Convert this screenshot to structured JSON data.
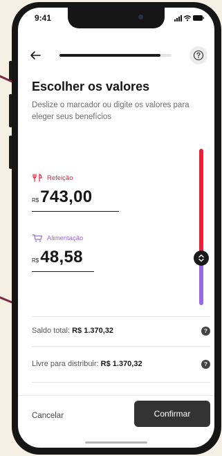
{
  "status_bar": {
    "time": "9:41"
  },
  "header": {
    "progress": 0.9,
    "back_icon": "arrow-left-icon",
    "help_icon": "question-circle-icon"
  },
  "page": {
    "title": "Escolher os valores",
    "subtitle": "Deslize o marcador ou digite os valores para eleger seus benefícios"
  },
  "categories": [
    {
      "label": "Refeição",
      "currency": "R$",
      "amount": "743,00",
      "color": "#e5213b",
      "icon": "fork-knife-icon"
    },
    {
      "label": "Alimentação",
      "currency": "R$",
      "amount": "48,58",
      "color": "#9a6be0",
      "icon": "shopping-cart-icon"
    }
  ],
  "slider": {
    "value": 0.7,
    "top_color": "#e5213b",
    "bottom_color": "#9a6be0"
  },
  "summary": {
    "total_label": "Saldo total:",
    "total_value": "R$ 1.370,32",
    "free_label": "Livre para distribuir:",
    "free_value": "R$ 1.370,32",
    "help_mark": "?"
  },
  "footer": {
    "cancel_label": "Cancelar",
    "confirm_label": "Confirmar"
  },
  "colors": {
    "background": "#f6efe3",
    "accent_line": "#7a2a45",
    "dark": "#333333"
  }
}
